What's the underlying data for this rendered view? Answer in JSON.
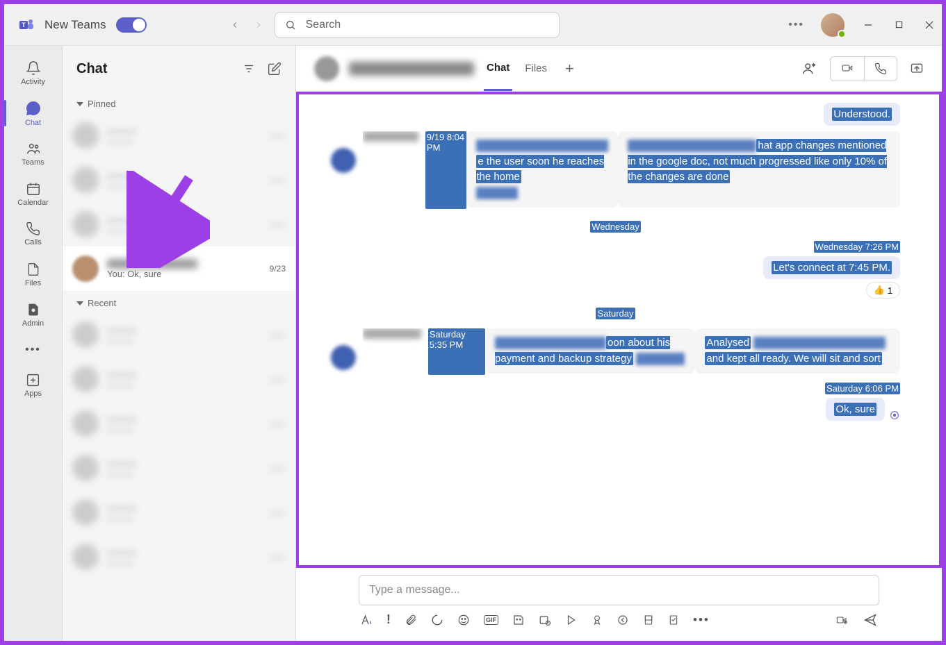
{
  "titlebar": {
    "app_name": "New Teams",
    "search_placeholder": "Search"
  },
  "rail": {
    "items": [
      {
        "label": "Activity"
      },
      {
        "label": "Chat"
      },
      {
        "label": "Teams"
      },
      {
        "label": "Calendar"
      },
      {
        "label": "Calls"
      },
      {
        "label": "Files"
      },
      {
        "label": "Admin"
      }
    ],
    "apps_label": "Apps"
  },
  "chatlist": {
    "title": "Chat",
    "pinned_label": "Pinned",
    "recent_label": "Recent",
    "selected_item": {
      "preview_prefix": "You: ",
      "preview_text": "Ok, sure",
      "date": "9/23"
    }
  },
  "conv_header": {
    "tabs": {
      "chat": "Chat",
      "files": "Files"
    }
  },
  "messages": {
    "out_understood": "Understood.",
    "in1_time": "9/19 8:04 PM",
    "in1_text1_visible": "e the user soon he reaches the home",
    "in1_text2_visible": "hat app changes mentioned in the google doc, not much progressed like only 10% of the changes are done",
    "sep_wed": "Wednesday",
    "out2_ts": "Wednesday 7:26 PM",
    "out2_text": "Let's connect at 7:45 PM.",
    "reaction_count": "1",
    "sep_sat": "Saturday",
    "in2_time": "Saturday 5:35 PM",
    "in2_text1_visible": "oon about his payment and backup strategy",
    "in2_text2_a": "Analysed",
    "in2_text2_b": "and kept all ready. We will sit and sort",
    "out3_ts": "Saturday 6:06 PM",
    "out3_text": "Ok, sure"
  },
  "compose": {
    "placeholder": "Type a message..."
  }
}
